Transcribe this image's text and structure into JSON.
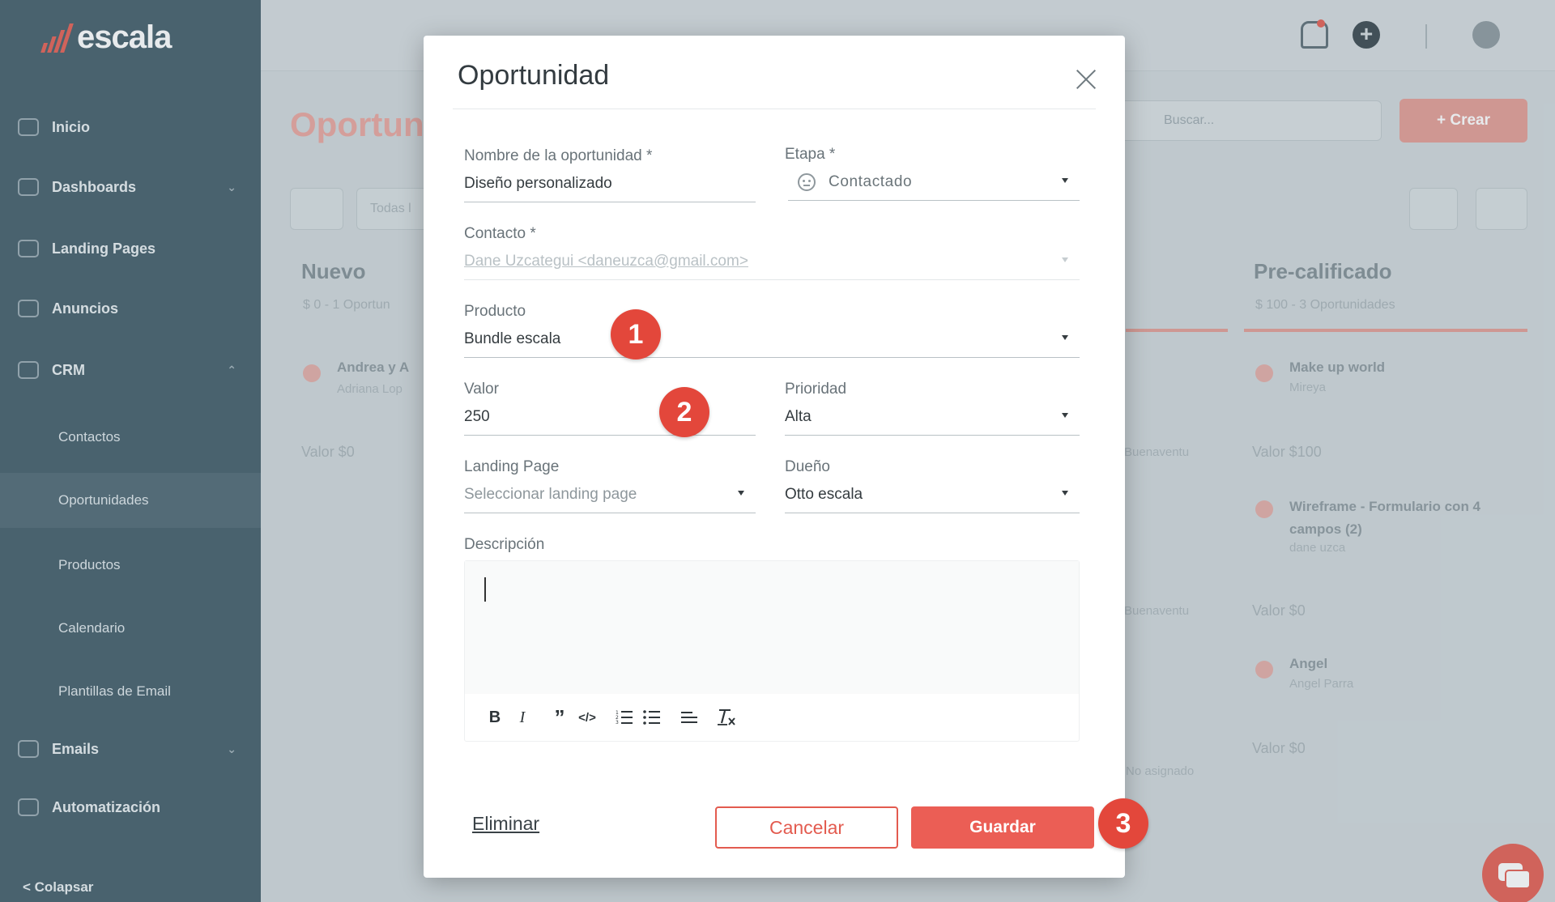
{
  "app": {
    "logo_text": "escala",
    "page_title": "Oportun",
    "search_placeholder": "Buscar...",
    "create_label": "+ Crear",
    "collapse_label": "< Colapsar"
  },
  "sidebar": {
    "items": [
      {
        "label": "Inicio",
        "icon": "home-icon"
      },
      {
        "label": "Dashboards",
        "icon": "chart-icon"
      },
      {
        "label": "Landing Pages",
        "icon": "page-icon"
      },
      {
        "label": "Anuncios",
        "icon": "globe-icon"
      },
      {
        "label": "CRM",
        "icon": "users-icon"
      },
      {
        "label": "Emails",
        "icon": "mail-icon"
      },
      {
        "label": "Automatización",
        "icon": "bolt-icon"
      }
    ],
    "crm_sub": [
      "Contactos",
      "Oportunidades",
      "Productos",
      "Calendario",
      "Plantillas de Email"
    ]
  },
  "board": {
    "filter_text": "Todas l",
    "columns": [
      {
        "name": "Nuevo",
        "summary": "$ 0 - 1 Oportun"
      },
      {
        "name": "Pre-calificado",
        "summary": "$ 100 - 3 Oportunidades"
      }
    ],
    "cards_left": [
      {
        "title": "Andrea y A",
        "sub": "Adriana Lop",
        "value": "Valor  $0"
      }
    ],
    "cards_right": [
      {
        "title": "Make up world",
        "sub": "Mireya",
        "value": "Valor  $100"
      },
      {
        "title": "Wireframe - Formulario con 4 campos (2)",
        "sub": "dane uzca",
        "value": "Valor  $0"
      },
      {
        "title": "Angel",
        "sub": "Angel Parra",
        "value": "Valor  $0"
      }
    ],
    "middle_labels": [
      "Buenaventu",
      "Buenaventu",
      "No asignado"
    ]
  },
  "modal": {
    "title": "Oportunidad",
    "fields": {
      "nombre": {
        "label": "Nombre de la oportunidad *",
        "value": "Diseño personalizado"
      },
      "etapa": {
        "label": "Etapa *",
        "value": "Contactado",
        "icon": "neutral-face-icon"
      },
      "contacto": {
        "label": "Contacto *",
        "value": "Dane Uzcategui <daneuzca@gmail.com>"
      },
      "producto": {
        "label": "Producto",
        "value": "Bundle escala"
      },
      "valor": {
        "label": "Valor",
        "value": "250"
      },
      "prioridad": {
        "label": "Prioridad",
        "value": "Alta"
      },
      "landing": {
        "label": "Landing Page",
        "placeholder": "Seleccionar landing page"
      },
      "dueno": {
        "label": "Dueño",
        "value": "Otto escala"
      },
      "descripcion": {
        "label": "Descripción",
        "value": ""
      }
    },
    "toolbar": [
      "bold-icon",
      "italic-icon",
      "blockquote-icon",
      "code-icon",
      "ordered-list-icon",
      "bullet-list-icon",
      "align-icon",
      "clear-format-icon"
    ],
    "buttons": {
      "delete": "Eliminar",
      "cancel": "Cancelar",
      "save": "Guardar"
    }
  },
  "annotations": [
    "1",
    "2",
    "3"
  ],
  "colors": {
    "accent": "#eb5e55",
    "badge": "#e3473b",
    "sidebar": "#3f5966"
  }
}
